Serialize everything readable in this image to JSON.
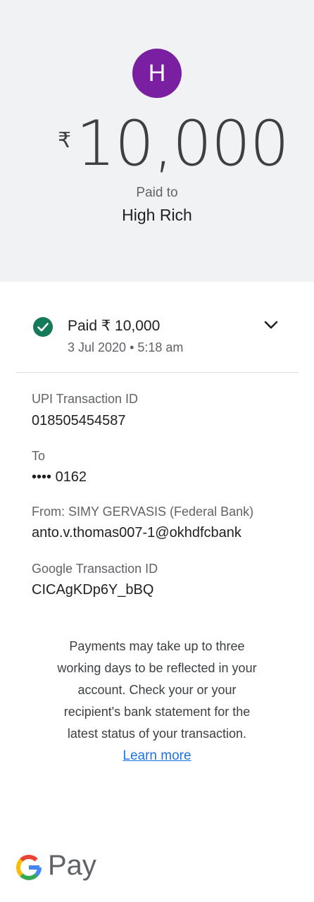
{
  "header": {
    "avatar_letter": "H",
    "currency_symbol": "₹",
    "amount": "10,000",
    "paid_to_label": "Paid to",
    "payee_name": "High Rich",
    "avatar_color": "#7b1fa2"
  },
  "status": {
    "title": "Paid ₹ 10,000",
    "date_time": "3 Jul 2020 • 5:18 am",
    "icon": "check-circle-icon",
    "color": "#137b5a"
  },
  "details": {
    "upi_label": "UPI Transaction ID",
    "upi_value": "018505454587",
    "to_label": "To",
    "to_value": "•••• 0162",
    "from_label": "From: SIMY GERVASIS (Federal Bank)",
    "from_value": "anto.v.thomas007-1@okhdfcbank",
    "google_label": "Google Transaction ID",
    "google_value": "CICAgKDp6Y_bBQ"
  },
  "note": {
    "text": "Payments may take up to three working days to be reflected in your account. Check your or your recipient's bank statement for the latest status of your transaction.",
    "link": "Learn more"
  },
  "footer": {
    "brand_text": "Pay"
  }
}
